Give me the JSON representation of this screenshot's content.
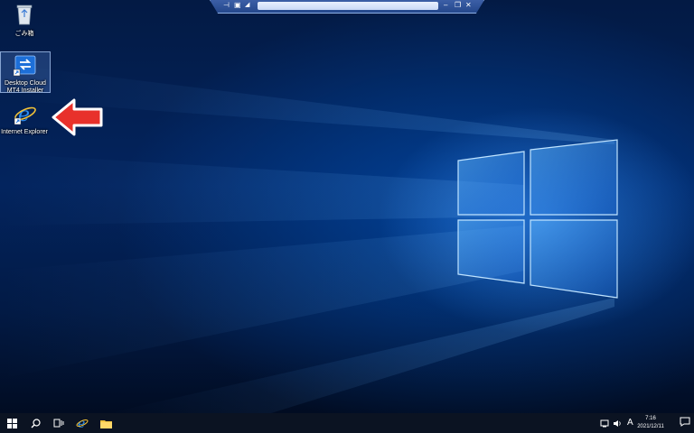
{
  "desktop": {
    "icons": [
      {
        "label": "ごみ箱"
      },
      {
        "label_line1": "Desktop Cloud",
        "label_line2": "MT4 Installer"
      },
      {
        "label": "Internet Explorer"
      }
    ]
  },
  "taskbar": {
    "clock_time": "7:16",
    "clock_date": "2021/12/11",
    "input_indicator": "A"
  },
  "colors": {
    "taskbar": "#0b1322",
    "arrow": "#e8312b",
    "wallpaper_light": "#4aa3ff"
  }
}
